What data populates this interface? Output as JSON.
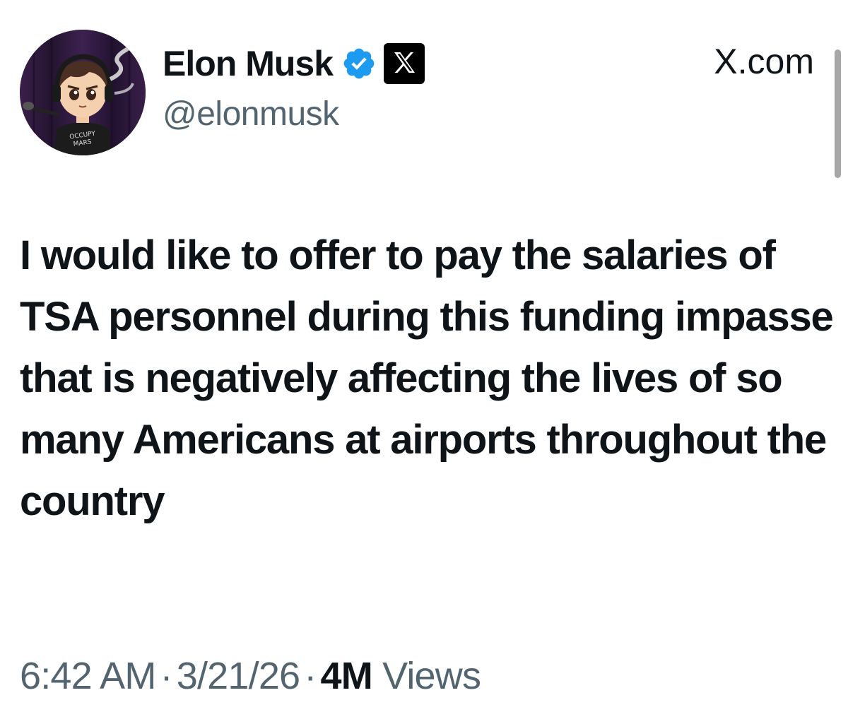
{
  "author": {
    "display_name": "Elon Musk",
    "handle": "@elonmusk",
    "verified": true,
    "verified_color": "#1d9bf0",
    "affiliation_icon": "x-logo-icon",
    "avatar_shirt_text": "OCCUPY MARS"
  },
  "site": {
    "label": "X.com"
  },
  "tweet": {
    "text": "I would like to offer to pay the salaries of TSA personnel during this funding impasse that is negatively affecting the lives of so many Americans at airports throughout the country"
  },
  "meta": {
    "time": "6:42 AM",
    "date": "3/21/26",
    "separator": "·",
    "views_count": "4M",
    "views_label": "Views"
  },
  "colors": {
    "text_primary": "#0f1419",
    "text_secondary": "#536471",
    "background": "#ffffff"
  }
}
